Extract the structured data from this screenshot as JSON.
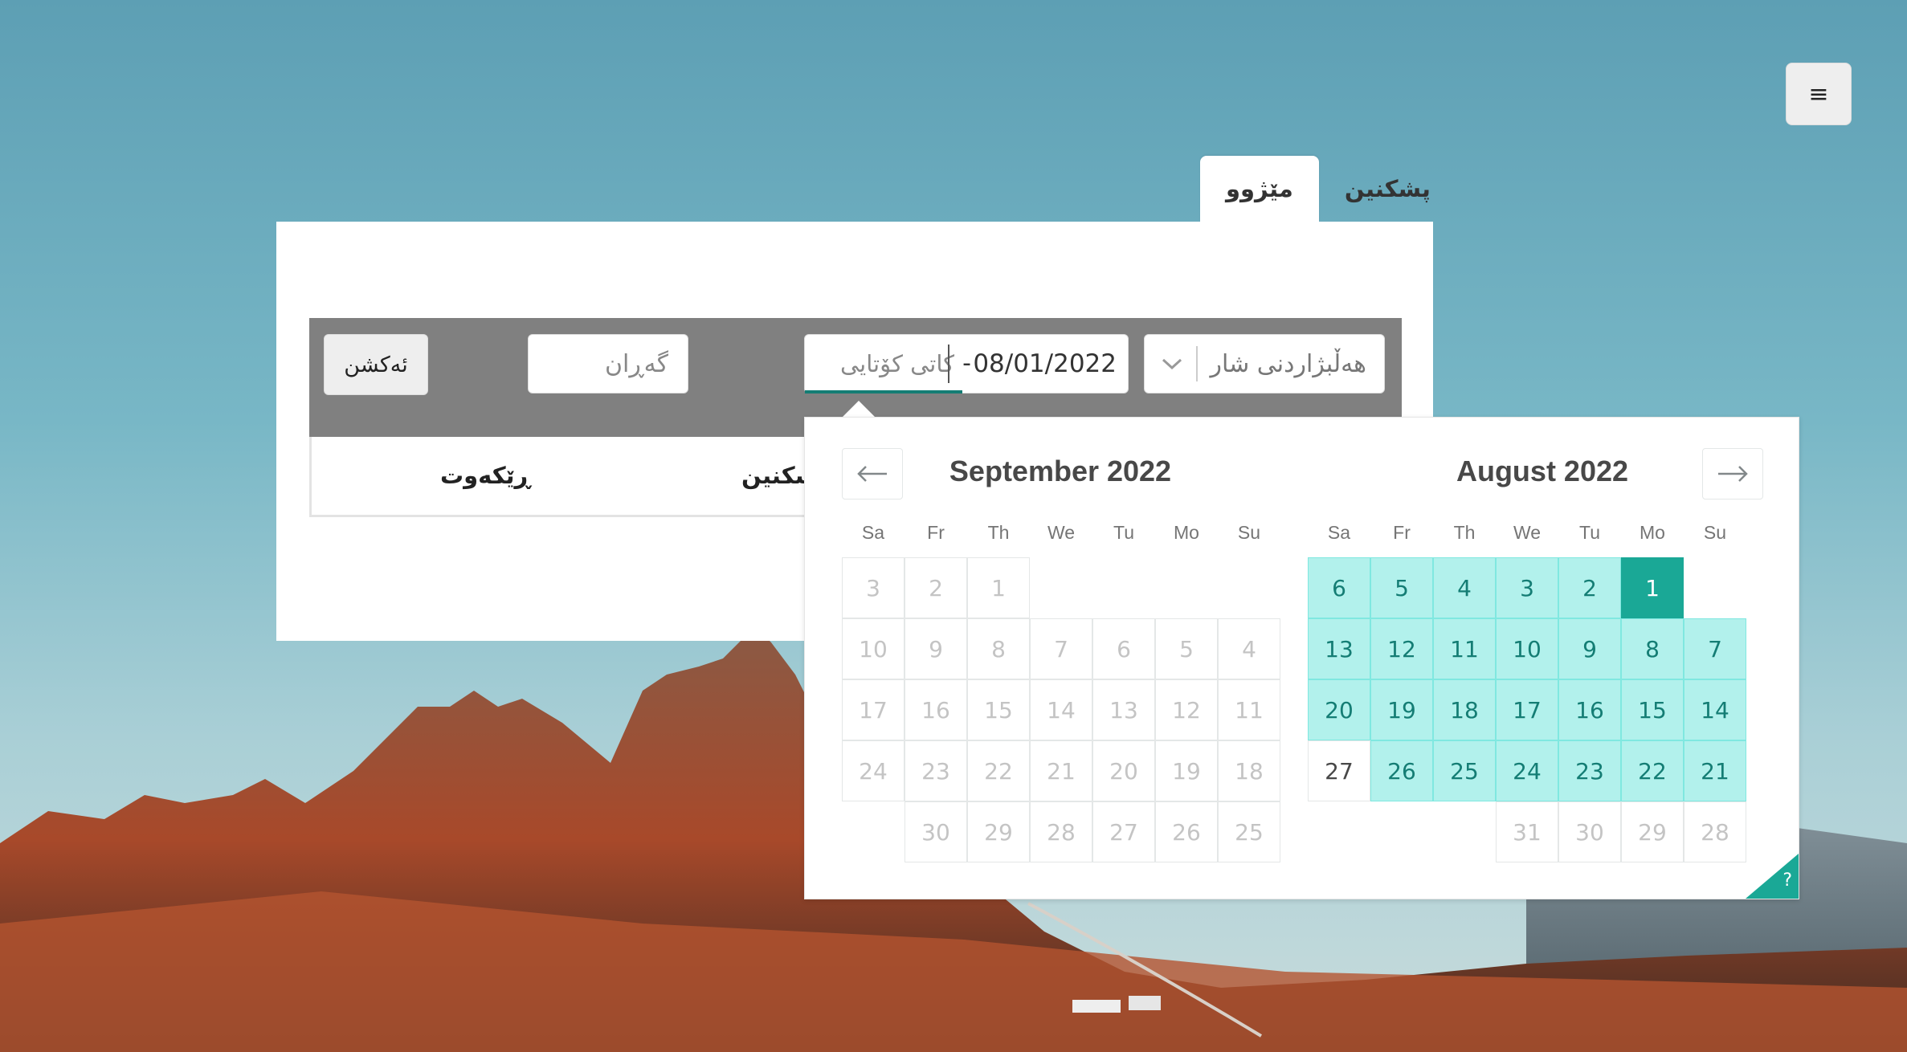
{
  "app": {
    "menu_glyph": "≡",
    "menu_icon": "hamburger-icon"
  },
  "tabs": [
    {
      "label": "پشکنین"
    },
    {
      "label": "مێژوو",
      "active": true
    }
  ],
  "search": {
    "city_placeholder": "هەڵبژاردنی شار",
    "chevron_icon": "chevron-down-icon",
    "date_start": "08/01/2022",
    "date_separator": "-",
    "date_end_placeholder": "کاتی کۆتایی",
    "search_placeholder": "گەڕان",
    "action_label": "ئەکشن"
  },
  "results": {
    "columns": [
      "پشکنین",
      "ڕێکەوت"
    ]
  },
  "datepicker": {
    "prev_icon": "arrow-left-icon",
    "next_icon": "arrow-right-icon",
    "help_glyph": "?",
    "weekdays": [
      "Sa",
      "Fr",
      "Th",
      "We",
      "Tu",
      "Mo",
      "Su"
    ],
    "months": [
      {
        "title": "September 2022",
        "weeks": [
          [
            {
              "d": "3"
            },
            {
              "d": "2"
            },
            {
              "d": "1"
            },
            null,
            null,
            null,
            null
          ],
          [
            {
              "d": "10"
            },
            {
              "d": "9"
            },
            {
              "d": "8"
            },
            {
              "d": "7"
            },
            {
              "d": "6"
            },
            {
              "d": "5"
            },
            {
              "d": "4"
            }
          ],
          [
            {
              "d": "17"
            },
            {
              "d": "16"
            },
            {
              "d": "15"
            },
            {
              "d": "14"
            },
            {
              "d": "13"
            },
            {
              "d": "12"
            },
            {
              "d": "11"
            }
          ],
          [
            {
              "d": "24"
            },
            {
              "d": "23"
            },
            {
              "d": "22"
            },
            {
              "d": "21"
            },
            {
              "d": "20"
            },
            {
              "d": "19"
            },
            {
              "d": "18"
            }
          ],
          [
            null,
            {
              "d": "30"
            },
            {
              "d": "29"
            },
            {
              "d": "28"
            },
            {
              "d": "27"
            },
            {
              "d": "26"
            },
            {
              "d": "25"
            }
          ]
        ]
      },
      {
        "title": "August 2022",
        "weeks": [
          [
            {
              "d": "6",
              "s": "span"
            },
            {
              "d": "5",
              "s": "span"
            },
            {
              "d": "4",
              "s": "span"
            },
            {
              "d": "3",
              "s": "span"
            },
            {
              "d": "2",
              "s": "span"
            },
            {
              "d": "1",
              "s": "sel"
            },
            null
          ],
          [
            {
              "d": "13",
              "s": "span"
            },
            {
              "d": "12",
              "s": "span"
            },
            {
              "d": "11",
              "s": "span"
            },
            {
              "d": "10",
              "s": "span"
            },
            {
              "d": "9",
              "s": "span"
            },
            {
              "d": "8",
              "s": "span"
            },
            {
              "d": "7",
              "s": "span"
            }
          ],
          [
            {
              "d": "20",
              "s": "span"
            },
            {
              "d": "19",
              "s": "span"
            },
            {
              "d": "18",
              "s": "span"
            },
            {
              "d": "17",
              "s": "span"
            },
            {
              "d": "16",
              "s": "span"
            },
            {
              "d": "15",
              "s": "span"
            },
            {
              "d": "14",
              "s": "span"
            }
          ],
          [
            {
              "d": "27",
              "s": "avail"
            },
            {
              "d": "26",
              "s": "span"
            },
            {
              "d": "25",
              "s": "span"
            },
            {
              "d": "24",
              "s": "span"
            },
            {
              "d": "23",
              "s": "span"
            },
            {
              "d": "22",
              "s": "span"
            },
            {
              "d": "21",
              "s": "span"
            }
          ],
          [
            null,
            null,
            null,
            {
              "d": "31"
            },
            {
              "d": "30"
            },
            {
              "d": "29"
            },
            {
              "d": "28"
            }
          ]
        ]
      }
    ]
  },
  "colors": {
    "accent": "#1aa896",
    "span_bg": "#b2f1ec",
    "span_text": "#147d74",
    "search_bar": "#808080"
  }
}
